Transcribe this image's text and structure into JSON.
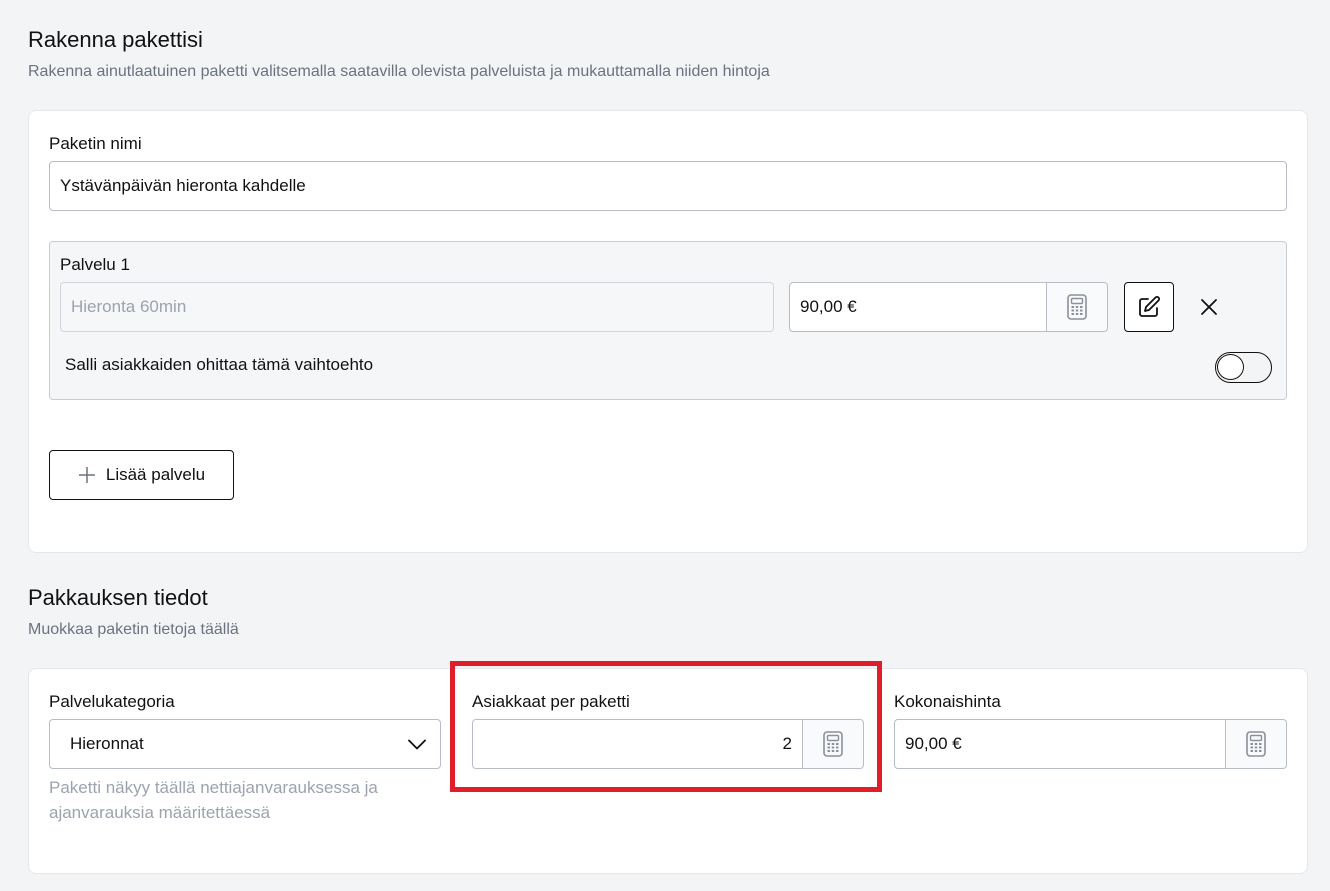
{
  "build": {
    "title": "Rakenna pakettisi",
    "subtitle": "Rakenna ainutlaatuinen paketti valitsemalla saatavilla olevista palveluista ja mukauttamalla niiden hintoja",
    "package_name_label": "Paketin nimi",
    "package_name_value": "Ystävänpäivän hieronta kahdelle",
    "service": {
      "label": "Palvelu 1",
      "name_placeholder": "Hieronta 60min",
      "price_value": "90,00 €",
      "skip_label": "Salli asiakkaiden ohittaa tämä vaihtoehto",
      "skip_enabled": false
    },
    "add_service_label": "Lisää palvelu"
  },
  "details": {
    "title": "Pakkauksen tiedot",
    "subtitle": "Muokkaa paketin tietoja täällä",
    "category_label": "Palvelukategoria",
    "category_value": "Hieronnat",
    "category_help": "Paketti näkyy täällä nettiajanvarauksessa ja ajanvarauksia määritettäessä",
    "customers_label": "Asiakkaat per paketti",
    "customers_value": "2",
    "total_label": "Kokonaishinta",
    "total_value": "90,00 €"
  },
  "colors": {
    "highlight": "#e11d2a",
    "background": "#f3f4f6"
  }
}
